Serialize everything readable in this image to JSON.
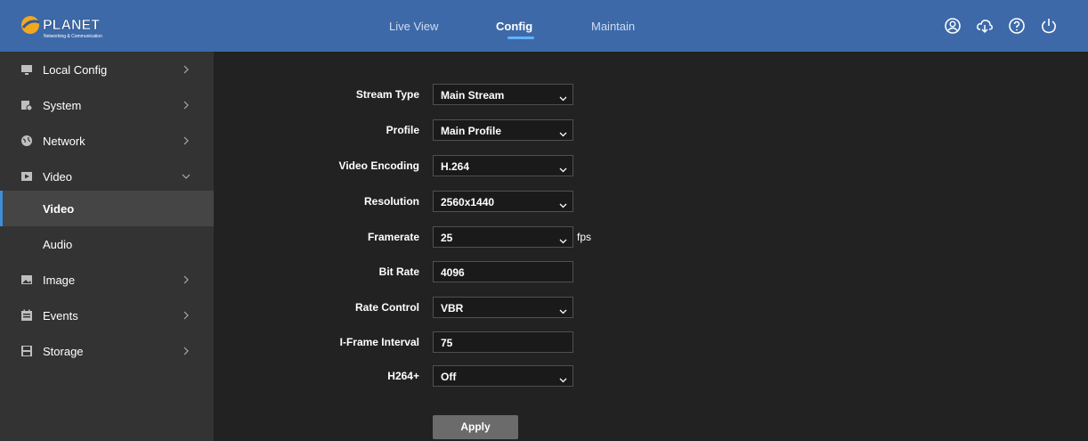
{
  "header": {
    "logo_text": "PLANET",
    "logo_tagline": "Networking & Communication",
    "tabs": [
      "Live View",
      "Config",
      "Maintain"
    ],
    "active_tab": "Config",
    "icons": [
      "user-icon",
      "cloud-download-icon",
      "help-icon",
      "power-icon"
    ]
  },
  "sidebar": {
    "items": [
      {
        "label": "Local Config",
        "icon": "monitor-icon"
      },
      {
        "label": "System",
        "icon": "system-icon"
      },
      {
        "label": "Network",
        "icon": "globe-icon"
      },
      {
        "label": "Video",
        "icon": "video-icon",
        "expanded": true
      },
      {
        "label": "Image",
        "icon": "image-icon"
      },
      {
        "label": "Events",
        "icon": "calendar-icon"
      },
      {
        "label": "Storage",
        "icon": "floppy-disk-icon"
      }
    ],
    "video_sub": [
      "Video",
      "Audio"
    ],
    "active_sub": "Video"
  },
  "form": {
    "stream_type": {
      "label": "Stream Type",
      "value": "Main Stream"
    },
    "profile": {
      "label": "Profile",
      "value": "Main Profile"
    },
    "video_encoding": {
      "label": "Video Encoding",
      "value": "H.264"
    },
    "resolution": {
      "label": "Resolution",
      "value": "2560x1440"
    },
    "framerate": {
      "label": "Framerate",
      "value": "25",
      "unit": "fps"
    },
    "bit_rate": {
      "label": "Bit Rate",
      "value": "4096"
    },
    "rate_control": {
      "label": "Rate Control",
      "value": "VBR"
    },
    "iframe_interval": {
      "label": "I-Frame Interval",
      "value": "75"
    },
    "h264_plus": {
      "label": "H264+",
      "value": "Off"
    },
    "apply_label": "Apply"
  },
  "colors": {
    "header_bg": "#3d69a8",
    "sidebar_bg": "#333333",
    "content_bg": "#222222",
    "active_accent": "#3d8ed8"
  }
}
